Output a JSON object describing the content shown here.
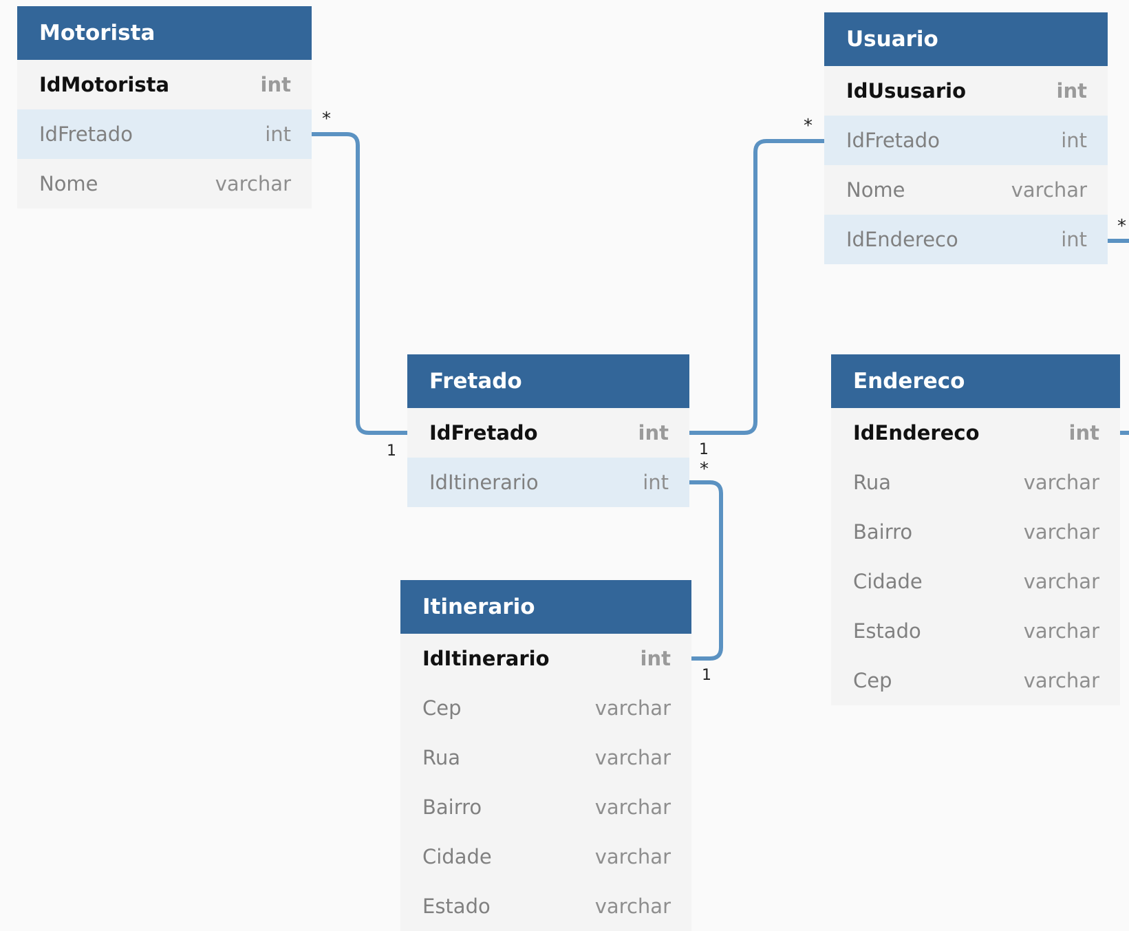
{
  "entities": [
    {
      "id": "motorista",
      "name": "Motorista",
      "fields": [
        {
          "name": "IdMotorista",
          "type": "int",
          "key": "pk"
        },
        {
          "name": "IdFretado",
          "type": "int",
          "key": "fk"
        },
        {
          "name": "Nome",
          "type": "varchar",
          "key": ""
        }
      ]
    },
    {
      "id": "usuario",
      "name": "Usuario",
      "fields": [
        {
          "name": "IdUsusario",
          "type": "int",
          "key": "pk"
        },
        {
          "name": "IdFretado",
          "type": "int",
          "key": "fk"
        },
        {
          "name": "Nome",
          "type": "varchar",
          "key": ""
        },
        {
          "name": "IdEndereco",
          "type": "int",
          "key": "fk"
        }
      ]
    },
    {
      "id": "fretado",
      "name": "Fretado",
      "fields": [
        {
          "name": "IdFretado",
          "type": "int",
          "key": "pk"
        },
        {
          "name": "IdItinerario",
          "type": "int",
          "key": "fk"
        }
      ]
    },
    {
      "id": "endereco",
      "name": "Endereco",
      "fields": [
        {
          "name": "IdEndereco",
          "type": "int",
          "key": "pk"
        },
        {
          "name": "Rua",
          "type": "varchar",
          "key": ""
        },
        {
          "name": "Bairro",
          "type": "varchar",
          "key": ""
        },
        {
          "name": "Cidade",
          "type": "varchar",
          "key": ""
        },
        {
          "name": "Estado",
          "type": "varchar",
          "key": ""
        },
        {
          "name": "Cep",
          "type": "varchar",
          "key": ""
        }
      ]
    },
    {
      "id": "itinerario",
      "name": "Itinerario",
      "fields": [
        {
          "name": "IdItinerario",
          "type": "int",
          "key": "pk"
        },
        {
          "name": "Cep",
          "type": "varchar",
          "key": ""
        },
        {
          "name": "Rua",
          "type": "varchar",
          "key": ""
        },
        {
          "name": "Bairro",
          "type": "varchar",
          "key": ""
        },
        {
          "name": "Cidade",
          "type": "varchar",
          "key": ""
        },
        {
          "name": "Estado",
          "type": "varchar",
          "key": ""
        }
      ]
    }
  ],
  "relationships": [
    {
      "id": "motorista-fretado",
      "from": "Motorista.IdFretado",
      "to": "Fretado.IdFretado",
      "from_card": "*",
      "to_card": "1"
    },
    {
      "id": "usuario-fretado",
      "from": "Usuario.IdFretado",
      "to": "Fretado.IdFretado",
      "from_card": "*",
      "to_card": "1"
    },
    {
      "id": "fretado-itinerario",
      "from": "Fretado.IdItinerario",
      "to": "Itinerario.IdItinerario",
      "from_card": "*",
      "to_card": "1"
    },
    {
      "id": "usuario-endereco",
      "from": "Usuario.IdEndereco",
      "to": "Endereco.IdEndereco",
      "from_card": "*",
      "to_card": ""
    }
  ],
  "colors": {
    "header": "#336699",
    "link": "#5b92c2",
    "fk_row": "#e1ecf5",
    "row": "#f4f4f4"
  }
}
